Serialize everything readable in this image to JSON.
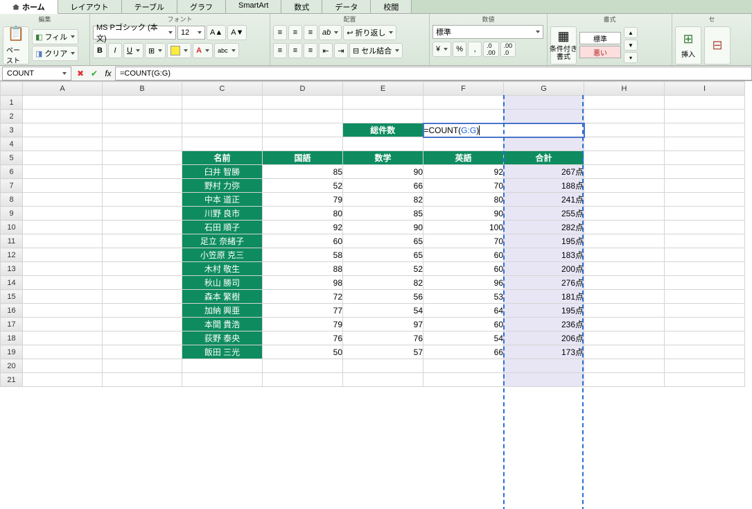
{
  "tabs": [
    "ホーム",
    "レイアウト",
    "テーブル",
    "グラフ",
    "SmartArt",
    "数式",
    "データ",
    "校閲"
  ],
  "activeTab": 0,
  "ribbon": {
    "groups": {
      "edit": {
        "label": "編集",
        "paste": "ペースト",
        "fill": "フィル",
        "clear": "クリア"
      },
      "font": {
        "label": "フォント",
        "name": "MS Pゴシック (本文)",
        "size": "12"
      },
      "align": {
        "label": "配置",
        "wrap": "折り返し",
        "merge": "セル結合"
      },
      "number": {
        "label": "数値",
        "format": "標準"
      },
      "styles": {
        "label": "書式",
        "condfmt": "条件付き\n書式",
        "s1": "標準",
        "s2": "悪い"
      },
      "cells": {
        "label": "セ",
        "insert": "挿入"
      }
    }
  },
  "formulaBar": {
    "nameBox": "COUNT",
    "fx": "fx",
    "formula": "=COUNT(G:G)"
  },
  "gridHeaders": [
    "A",
    "B",
    "C",
    "D",
    "E",
    "F",
    "G",
    "H",
    "I"
  ],
  "labelRow": {
    "E": "総件数"
  },
  "formulaDisplay": {
    "pre": "=COUNT(",
    "ref": "G:G",
    "post": ")"
  },
  "tableHeaders": {
    "name": "名前",
    "kokugo": "国語",
    "suugaku": "数学",
    "eigo": "英語",
    "goukei": "合計"
  },
  "rows": [
    {
      "r": 6,
      "name": "臼井 智勝",
      "k": 85,
      "s": 90,
      "e": 92,
      "t": "267点"
    },
    {
      "r": 7,
      "name": "野村 力弥",
      "k": 52,
      "s": 66,
      "e": 70,
      "t": "188点"
    },
    {
      "r": 8,
      "name": "中本 道正",
      "k": 79,
      "s": 82,
      "e": 80,
      "t": "241点"
    },
    {
      "r": 9,
      "name": "川野 良市",
      "k": 80,
      "s": 85,
      "e": 90,
      "t": "255点"
    },
    {
      "r": 10,
      "name": "石田 順子",
      "k": 92,
      "s": 90,
      "e": 100,
      "t": "282点"
    },
    {
      "r": 11,
      "name": "足立 奈緒子",
      "k": 60,
      "s": 65,
      "e": 70,
      "t": "195点"
    },
    {
      "r": 12,
      "name": "小笠原 克三",
      "k": 58,
      "s": 65,
      "e": 60,
      "t": "183点"
    },
    {
      "r": 13,
      "name": "木村 敬生",
      "k": 88,
      "s": 52,
      "e": 60,
      "t": "200点"
    },
    {
      "r": 14,
      "name": "秋山 勝司",
      "k": 98,
      "s": 82,
      "e": 96,
      "t": "276点"
    },
    {
      "r": 15,
      "name": "森本 繁樹",
      "k": 72,
      "s": 56,
      "e": 53,
      "t": "181点"
    },
    {
      "r": 16,
      "name": "加納 興亜",
      "k": 77,
      "s": 54,
      "e": 64,
      "t": "195点"
    },
    {
      "r": 17,
      "name": "本間 貴浩",
      "k": 79,
      "s": 97,
      "e": 60,
      "t": "236点"
    },
    {
      "r": 18,
      "name": "荻野 泰央",
      "k": 76,
      "s": 76,
      "e": 54,
      "t": "206点"
    },
    {
      "r": 19,
      "name": "飯田 三光",
      "k": 50,
      "s": 57,
      "e": 66,
      "t": "173点"
    }
  ],
  "blankRows": [
    1,
    2,
    4,
    20,
    21
  ],
  "visibleRowNums": [
    1,
    2,
    3,
    4,
    5,
    6,
    7,
    8,
    9,
    10,
    11,
    12,
    13,
    14,
    15,
    16,
    17,
    18,
    19,
    20,
    21
  ]
}
